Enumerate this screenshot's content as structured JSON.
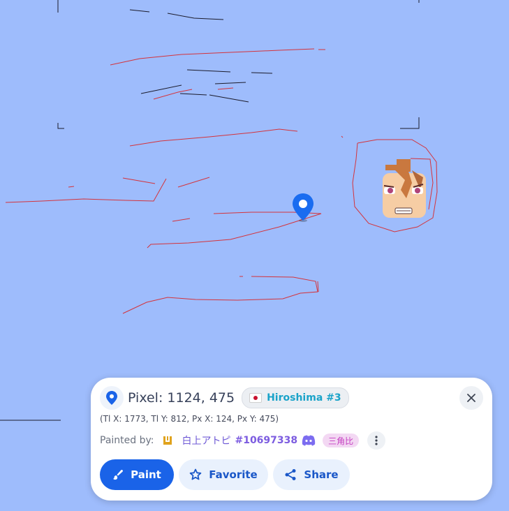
{
  "map": {
    "background": "#9ebcfc",
    "stroke_color": "#d4333b",
    "pin_color": "#1a6cf0"
  },
  "info_panel": {
    "title": "Pixel: 1124, 475",
    "region": {
      "flag": "japan-flag",
      "name": "Hiroshima #3",
      "color": "#1aa3c9"
    },
    "coords": "(Tl X: 1773, Tl Y: 812, Px X: 124, Px Y: 475)",
    "painted_by_label": "Painted by:",
    "user": {
      "name": "白上アトピ",
      "id": "#10697338",
      "alliance": "三角比"
    },
    "actions": {
      "paint": "Paint",
      "favorite": "Favorite",
      "share": "Share"
    },
    "accent_color": "#1a63e8"
  }
}
